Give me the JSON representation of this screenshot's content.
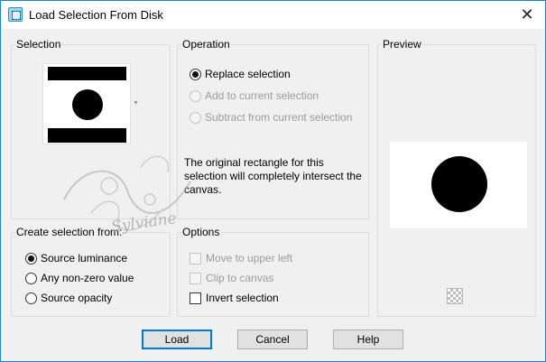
{
  "window": {
    "title": "Load Selection From Disk",
    "close_glyph": "✕"
  },
  "selection_group": {
    "label": "Selection"
  },
  "operation_group": {
    "label": "Operation",
    "options": [
      {
        "label": "Replace selection",
        "selected": true,
        "enabled": true
      },
      {
        "label": "Add to current selection",
        "selected": false,
        "enabled": false
      },
      {
        "label": "Subtract from current selection",
        "selected": false,
        "enabled": false
      }
    ],
    "note": "The original rectangle for this selection will completely intersect the canvas."
  },
  "preview_group": {
    "label": "Preview"
  },
  "create_group": {
    "label": "Create selection from:",
    "options": [
      {
        "label": "Source luminance",
        "selected": true
      },
      {
        "label": "Any non-zero value",
        "selected": false
      },
      {
        "label": "Source opacity",
        "selected": false
      }
    ]
  },
  "options_group": {
    "label": "Options",
    "items": [
      {
        "label": "Move to upper left",
        "checked": false,
        "enabled": false
      },
      {
        "label": "Clip to canvas",
        "checked": false,
        "enabled": false
      },
      {
        "label": "Invert selection",
        "checked": false,
        "enabled": true
      }
    ]
  },
  "buttons": {
    "load": "Load",
    "cancel": "Cancel",
    "help": "Help"
  },
  "watermark": {
    "text": "Sylviane"
  },
  "icons": {
    "app": "selection-icon",
    "close": "close-icon",
    "transparency": "checkerboard-icon"
  }
}
